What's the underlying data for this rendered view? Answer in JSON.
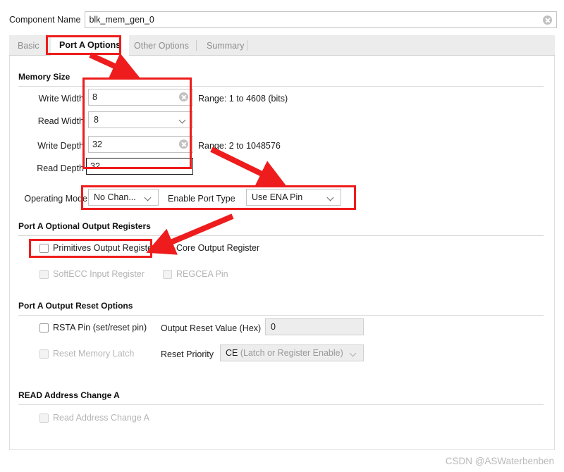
{
  "window": {
    "component_name_label": "Component Name",
    "component_name_value": "blk_mem_gen_0",
    "clear_icon": "clear-circle-icon"
  },
  "tabs": [
    {
      "label": "Basic",
      "active": false
    },
    {
      "label": "Port A Options",
      "active": true
    },
    {
      "label": "Other Options",
      "active": false
    },
    {
      "label": "Summary",
      "active": false
    }
  ],
  "memory_size": {
    "heading": "Memory Size",
    "write_width": {
      "label": "Write Width",
      "value": "8",
      "range": "Range: 1 to 4608 (bits)"
    },
    "read_width": {
      "label": "Read Width",
      "value": "8"
    },
    "write_depth": {
      "label": "Write Depth",
      "value": "32",
      "range": "Range: 2 to 1048576"
    },
    "read_depth": {
      "label": "Read Depth",
      "value": "32"
    }
  },
  "operating": {
    "mode_label": "Operating Mode",
    "mode_value": "No Chan...",
    "enable_port_label": "Enable Port Type",
    "enable_port_value": "Use ENA Pin"
  },
  "optional_output_registers": {
    "heading": "Port A Optional Output Registers",
    "items": [
      {
        "label": "Primitives Output Register",
        "checked": false,
        "disabled": false
      },
      {
        "label": "Core Output Register",
        "checked": false,
        "disabled": false
      },
      {
        "label": "SoftECC Input Register",
        "checked": false,
        "disabled": true
      },
      {
        "label": "REGCEA Pin",
        "checked": false,
        "disabled": true
      }
    ]
  },
  "output_reset_options": {
    "heading": "Port A Output Reset Options",
    "rsta_pin": {
      "label": "RSTA Pin (set/reset pin)",
      "checked": false,
      "disabled": false
    },
    "reset_memory_latch": {
      "label": "Reset Memory Latch",
      "checked": false,
      "disabled": true
    },
    "output_reset_value_label": "Output Reset Value (Hex)",
    "output_reset_value": "0",
    "reset_priority_label": "Reset Priority",
    "reset_priority_value": "CE",
    "reset_priority_suffix": "(Latch or Register Enable)"
  },
  "read_address_change": {
    "heading": "READ Address Change A",
    "checkbox": {
      "label": "Read Address Change A",
      "checked": false,
      "disabled": true
    }
  },
  "annotations": {
    "accent_color": "#ee1c1c",
    "boxes": [
      "tab-port-a-options",
      "memory-size-fields",
      "operating-mode-row",
      "primitives-output-register"
    ],
    "arrows": [
      "arrow-tab-to-memory-fields",
      "arrow-range-to-operating-mode",
      "arrow-to-primitives-output-register"
    ]
  },
  "watermark": "CSDN @ASWaterbenben"
}
